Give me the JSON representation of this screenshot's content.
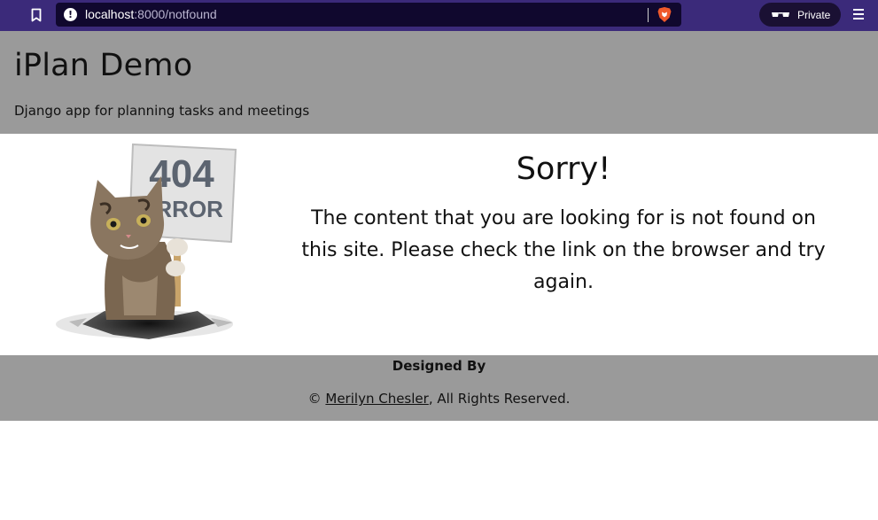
{
  "browser": {
    "url_host": "localhost",
    "url_rest": ":8000/notfound",
    "private_label": "Private"
  },
  "header": {
    "title": "iPlan Demo",
    "subtitle": "Django app for planning tasks and meetings"
  },
  "main": {
    "sign_number": "404",
    "sign_word": "ERROR",
    "heading": "Sorry!",
    "message": "The content that you are looking for is not found on this site. Please check the link on the browser and try again."
  },
  "footer": {
    "designed_by": "Designed By",
    "copyright_prefix": "© ",
    "author_link": "Merilyn Chesler",
    "copyright_suffix": ", All Rights Reserved."
  },
  "colors": {
    "chrome": "#3b2a7a",
    "urlbar": "#10082e",
    "header_footer": "#9a9a9a"
  }
}
